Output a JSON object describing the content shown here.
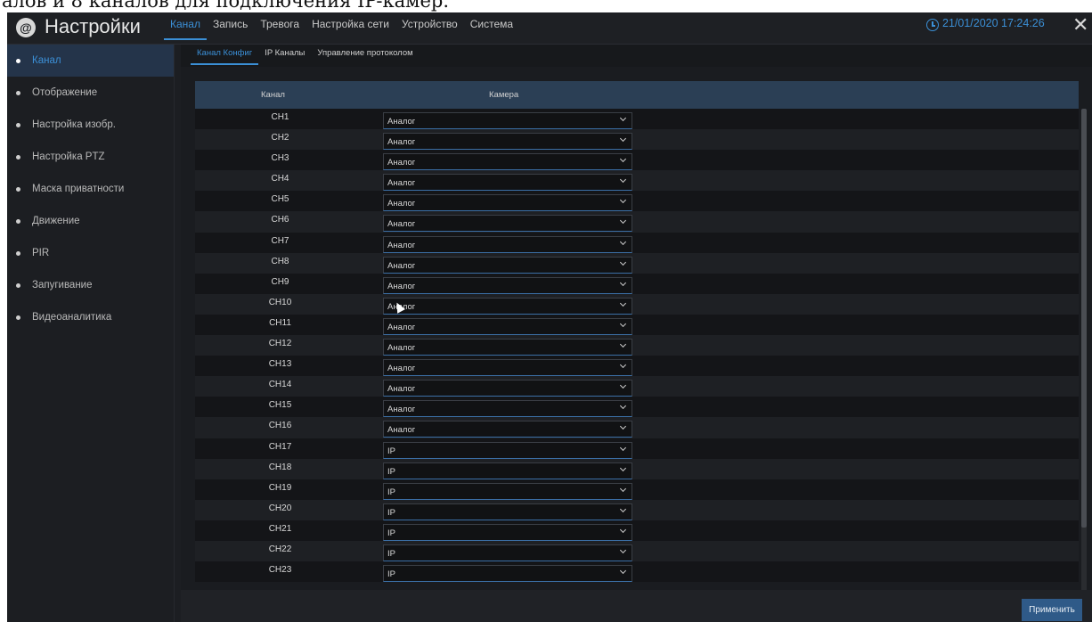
{
  "caption": "алов и 8 каналов для подключения IP-камер.",
  "header": {
    "app_title": "Настройки",
    "tabs": [
      "Канал",
      "Запись",
      "Тревога",
      "Настройка сети",
      "Устройство",
      "Система"
    ],
    "active_tab": "Канал",
    "datetime": "21/01/2020 17:24:26",
    "close_symbol": "✕"
  },
  "sidebar": {
    "active_item": "Канал",
    "items": [
      "Канал",
      "Отображение",
      "Настройка изобр.",
      "Настройка PTZ",
      "Маска приватности",
      "Движение",
      "PIR",
      "Запугивание",
      "Видеоаналитика"
    ]
  },
  "subtabs": {
    "items": [
      "Канал Конфиг",
      "IP Каналы",
      "Управление протоколом"
    ],
    "active_item": "Канал Конфиг"
  },
  "table": {
    "headers": {
      "channel": "Канал",
      "camera": "Камера"
    },
    "rows": [
      {
        "channel": "CH1",
        "camera": "Аналог"
      },
      {
        "channel": "CH2",
        "camera": "Аналог"
      },
      {
        "channel": "CH3",
        "camera": "Аналог"
      },
      {
        "channel": "CH4",
        "camera": "Аналог"
      },
      {
        "channel": "CH5",
        "camera": "Аналог"
      },
      {
        "channel": "CH6",
        "camera": "Аналог"
      },
      {
        "channel": "CH7",
        "camera": "Аналог"
      },
      {
        "channel": "CH8",
        "camera": "Аналог"
      },
      {
        "channel": "CH9",
        "camera": "Аналог"
      },
      {
        "channel": "CH10",
        "camera": "Аналог"
      },
      {
        "channel": "CH11",
        "camera": "Аналог"
      },
      {
        "channel": "CH12",
        "camera": "Аналог"
      },
      {
        "channel": "CH13",
        "camera": "Аналог"
      },
      {
        "channel": "CH14",
        "camera": "Аналог"
      },
      {
        "channel": "CH15",
        "camera": "Аналог"
      },
      {
        "channel": "CH16",
        "camera": "Аналог"
      },
      {
        "channel": "CH17",
        "camera": "IP"
      },
      {
        "channel": "CH18",
        "camera": "IP"
      },
      {
        "channel": "CH19",
        "camera": "IP"
      },
      {
        "channel": "CH20",
        "camera": "IP"
      },
      {
        "channel": "CH21",
        "camera": "IP"
      },
      {
        "channel": "CH22",
        "camera": "IP"
      },
      {
        "channel": "CH23",
        "camera": "IP"
      }
    ]
  },
  "footer": {
    "apply_label": "Применить"
  },
  "colors": {
    "accent": "#3b8fd6",
    "background": "#1c1e22",
    "header_row": "#2b3f55",
    "apply_button": "#2f5a88"
  },
  "icons": [
    "logo-icon",
    "clock-icon",
    "close-icon",
    "chevron-down-icon",
    "mouse-cursor-icon"
  ]
}
